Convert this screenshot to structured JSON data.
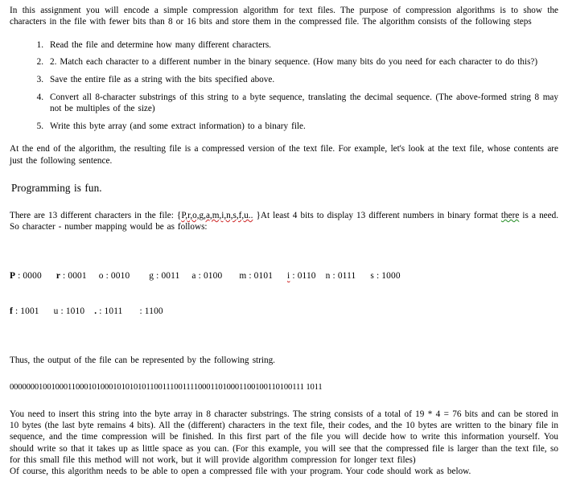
{
  "document": {
    "intro_paragraph": "In this assignment you will encode a simple compression algorithm for text files. The purpose of compression algorithms is to show the characters in the file with fewer bits than 8 or 16 bits and store them in the compressed file. The algorithm consists of the following steps",
    "steps": [
      "Read the file and determine how many different characters.",
      "2. Match each character to a different number in the binary sequence. (How many bits do you need for each character to do this?)",
      "Save the entire file as a string with the bits specified above.",
      "Convert all 8-character substrings of this string to a byte sequence, translating the decimal sequence. (The above-formed string 8 may not be multiples of the size)",
      "Write this byte array (and some extract information) to a binary file."
    ],
    "after_algorithm_paragraph": "At the end of the algorithm, the resulting file is a compressed version of the text file. For example, let's look at the text file, whose contents are just the following sentence.",
    "example_sentence": "Programming is fun.",
    "charset_paragraph": {
      "lead": "There are 13 different characters in the file: {",
      "charset": "P,r,o,g,a,m,i,n,s,f,u..",
      "middle": " }At least 4 bits to display 13 different numbers in binary format ",
      "misspelled_word": "there",
      "tail": " is a need. So character - number mapping would be as follows:"
    },
    "mapping_rows": [
      [
        {
          "char": "P",
          "bold": true,
          "code": "0000"
        },
        {
          "char": "r",
          "bold": true,
          "code": "0001"
        },
        {
          "char": "o",
          "bold": false,
          "code": "0010"
        },
        {
          "char": "g",
          "bold": false,
          "code": "0011"
        },
        {
          "char": "a",
          "bold": false,
          "code": "0100"
        },
        {
          "char": "m",
          "bold": false,
          "code": "0101"
        },
        {
          "char": "i",
          "bold": false,
          "code": "0110",
          "squiggle": "red"
        },
        {
          "char": "n",
          "bold": false,
          "code": "0111"
        },
        {
          "char": "s",
          "bold": false,
          "code": "1000"
        }
      ],
      [
        {
          "char": "f",
          "bold": true,
          "code": "1001"
        },
        {
          "char": "u",
          "bold": false,
          "code": "1010"
        },
        {
          "char": ".",
          "bold": true,
          "code": "1011"
        },
        {
          "char": "",
          "bold": false,
          "code": "1100"
        }
      ]
    ],
    "mapping_line_1": "P : 0000      r : 0001     o : 0010        g : 0011     a : 0100       m : 0101      i : 0110    n : 0111      s : 1000",
    "mapping_line_2": "f : 1001      u : 1010    . : 1011       : 1100",
    "thus_paragraph": "Thus, the output of the file can be represented by the following string.",
    "binary_string": "000000010010001100010100010101010110011100111100011010001100100110100111 1011",
    "closing_paragraph": "You need to insert this string into the byte array in 8 character substrings. The string consists of a total of 19 * 4 = 76 bits and can be stored in 10 bytes (the last byte remains 4 bits). All the (different) characters in the text file, their codes, and the 10 bytes are written to the binary file in sequence, and the time compression will be finished. In this first part of the file you will decide how to write this information yourself. You should write so that it takes up as little space as you can. (For this example, you will see that the compressed file is larger than the text file, so for this small file this method will not work, but it will provide algorithm compression for longer text files)",
    "final_line": "Of course, this algorithm needs to be able to open a compressed file with your program. Your code should work as below."
  },
  "colors": {
    "text": "#000000",
    "background": "#ffffff",
    "spellcheck_error": "#cc2020",
    "grammar_error": "#1f8a1f"
  }
}
